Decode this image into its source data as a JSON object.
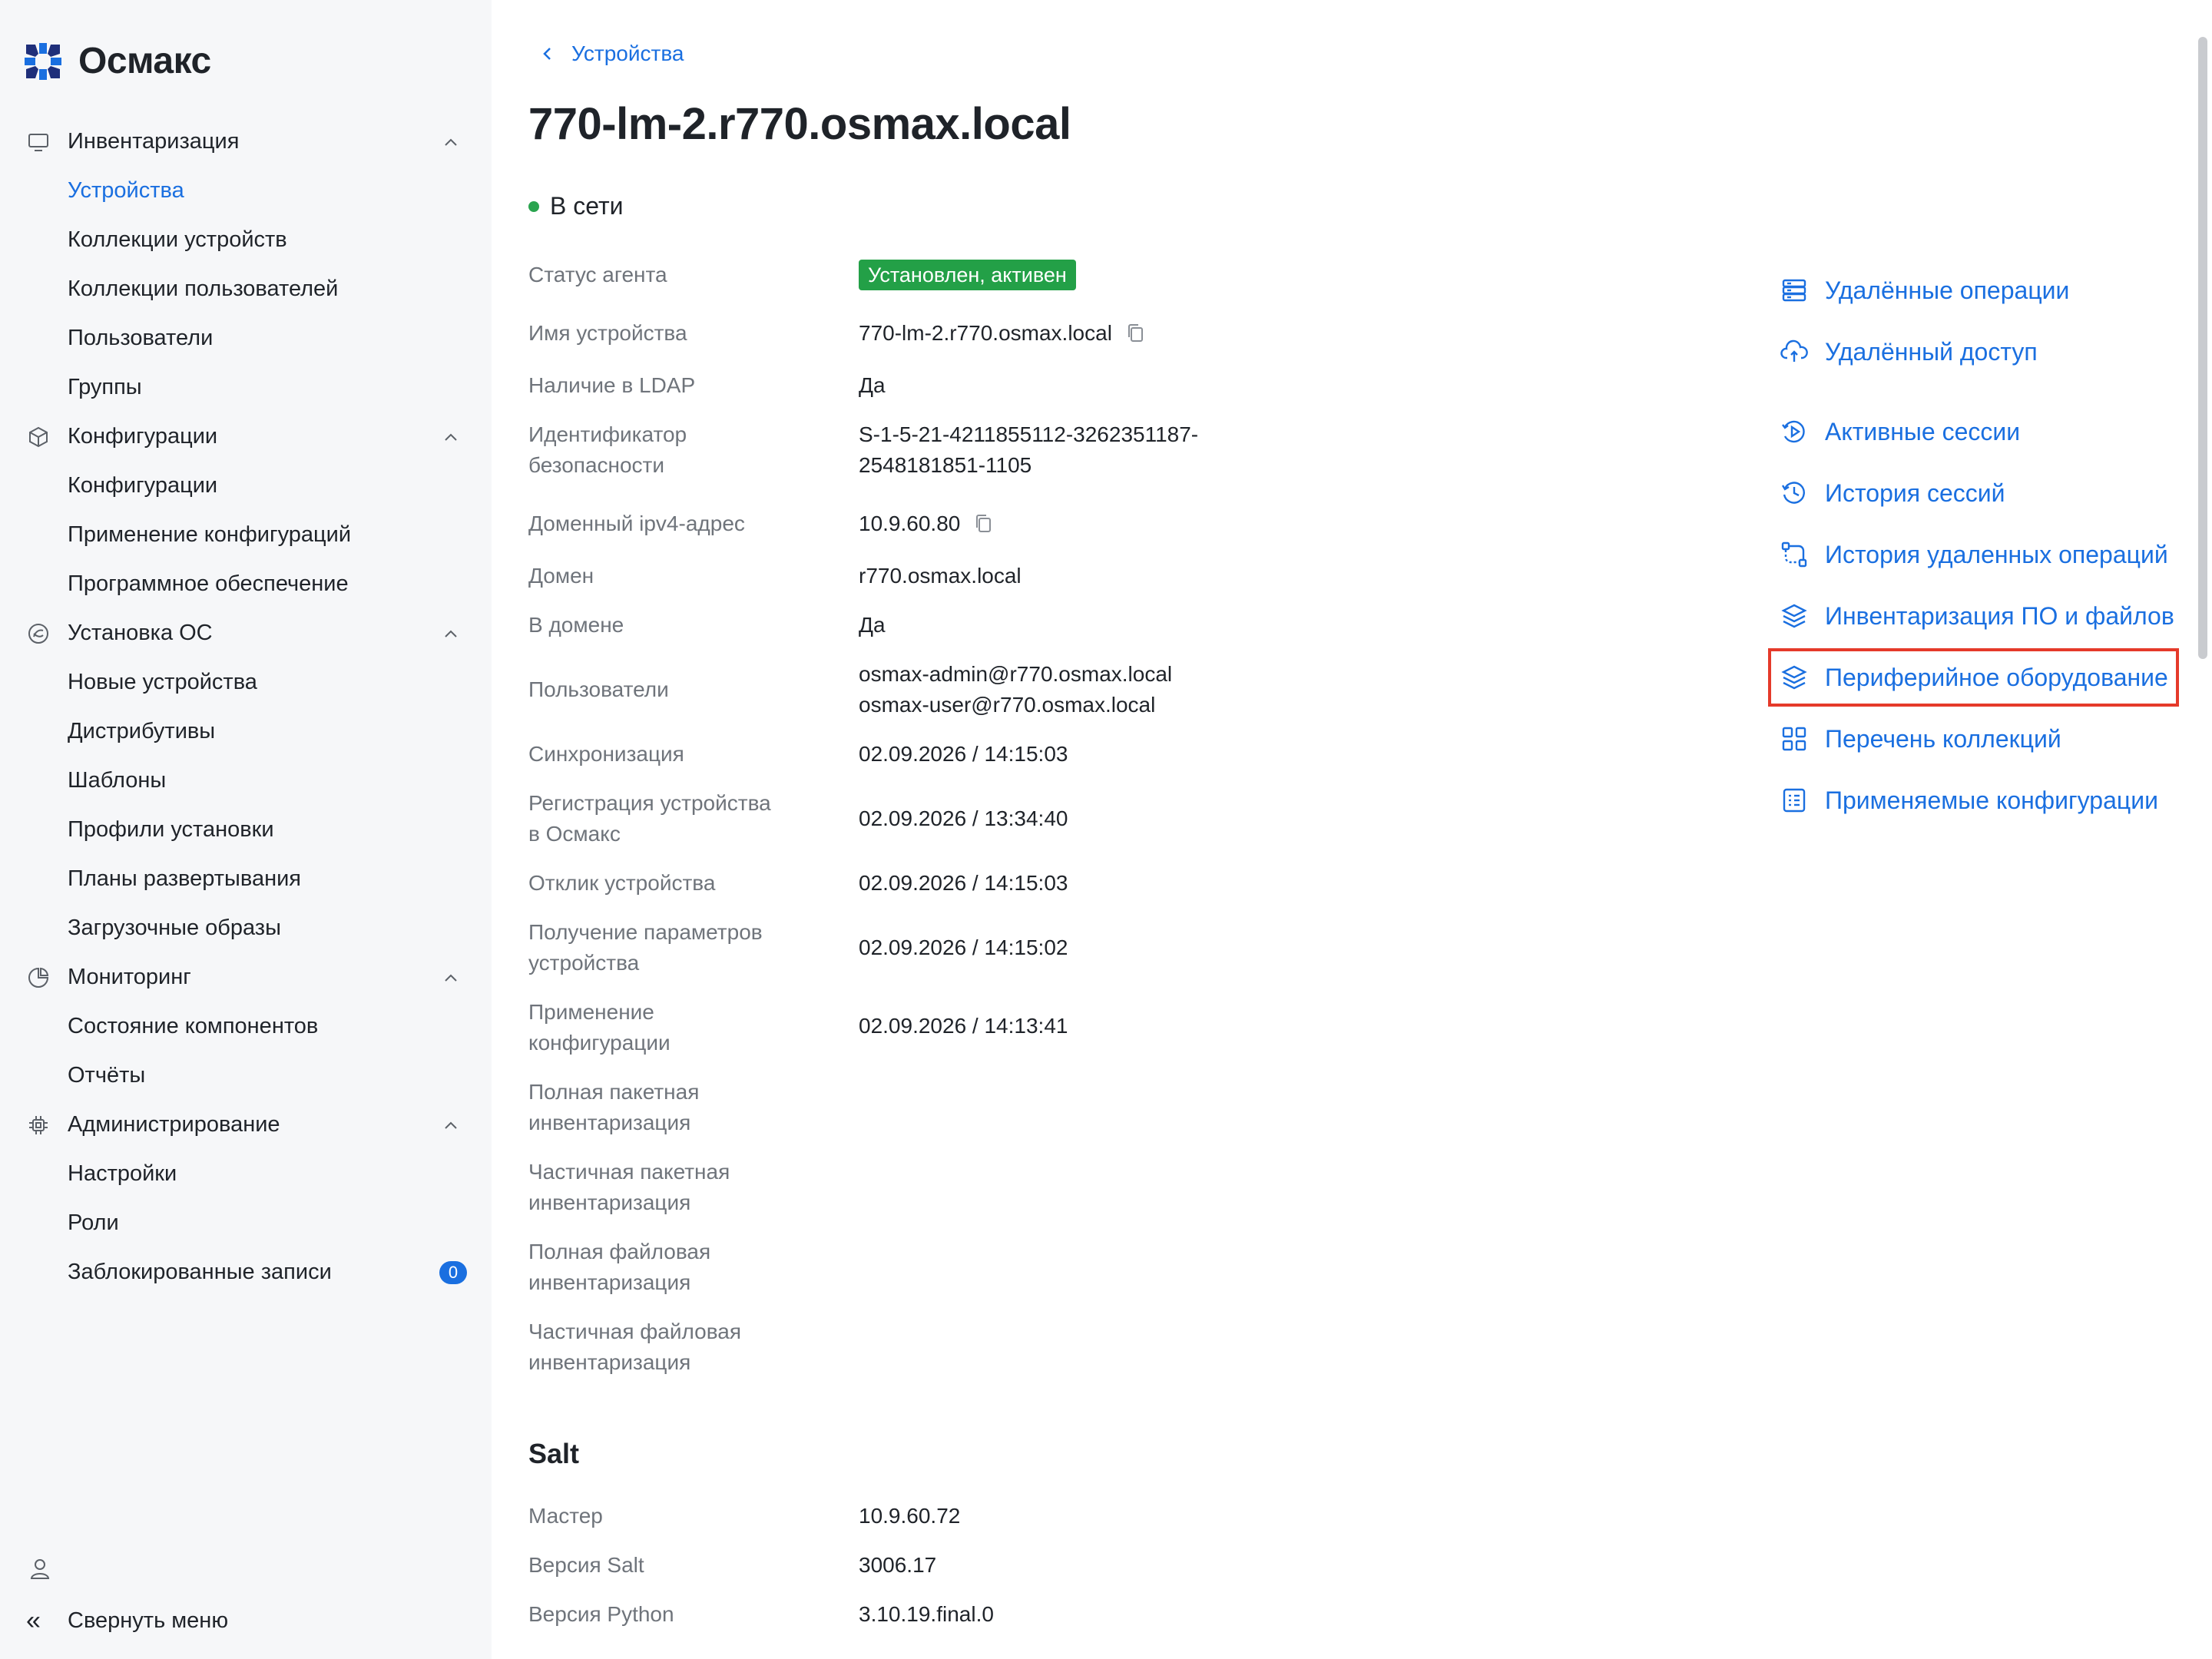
{
  "app": {
    "name": "Осмакс"
  },
  "sidebar": {
    "groups": [
      {
        "label": "Инвентаризация",
        "icon": "monitor-icon",
        "items": [
          "Устройства",
          "Коллекции устройств",
          "Коллекции пользователей",
          "Пользователи",
          "Группы"
        ]
      },
      {
        "label": "Конфигурации",
        "icon": "box-icon",
        "items": [
          "Конфигурации",
          "Применение конфигураций",
          "Программное обеспечение"
        ]
      },
      {
        "label": "Установка ОС",
        "icon": "os-install-icon",
        "items": [
          "Новые устройства",
          "Дистрибутивы",
          "Шаблоны",
          "Профили установки",
          "Планы развертывания",
          "Загрузочные образы"
        ]
      },
      {
        "label": "Мониторинг",
        "icon": "pie-chart-icon",
        "items": [
          "Состояние компонентов",
          "Отчёты"
        ]
      },
      {
        "label": "Администрирование",
        "icon": "cpu-icon",
        "items": [
          "Настройки",
          "Роли",
          "Заблокированные записи"
        ]
      }
    ],
    "active_item": "Устройства",
    "blocked_badge": "0",
    "collapse_label": "Свернуть меню"
  },
  "breadcrumb": {
    "back_label": "Устройства"
  },
  "device": {
    "title": "770-lm-2.r770.osmax.local",
    "network_status": "В сети",
    "fields": {
      "agent_status": {
        "label": "Статус агента",
        "value": "Установлен, активен"
      },
      "device_name": {
        "label": "Имя устройства",
        "value": "770-lm-2.r770.osmax.local"
      },
      "ldap": {
        "label": "Наличие в LDAP",
        "value": "Да"
      },
      "sid": {
        "label_1": "Идентификатор",
        "label_2": "безопасности",
        "value_1": "S-1-5-21-4211855112-3262351187-",
        "value_2": "2548181851-1105"
      },
      "ipv4": {
        "label": "Доменный ipv4-адрес",
        "value": "10.9.60.80"
      },
      "domain": {
        "label": "Домен",
        "value": "r770.osmax.local"
      },
      "in_domain": {
        "label": "В домене",
        "value": "Да"
      },
      "users": {
        "label": "Пользователи",
        "value_1": "osmax-admin@r770.osmax.local",
        "value_2": "osmax-user@r770.osmax.local"
      },
      "sync": {
        "label": "Синхронизация",
        "value": "02.09.2026 / 14:15:03"
      },
      "registration": {
        "label_1": "Регистрация устройства",
        "label_2": "в Осмакс",
        "value": "02.09.2026 / 13:34:40"
      },
      "response": {
        "label": "Отклик устройства",
        "value": "02.09.2026 / 14:15:03"
      },
      "params": {
        "label_1": "Получение параметров",
        "label_2": "устройства",
        "value": "02.09.2026 / 14:15:02"
      },
      "apply_config": {
        "label_1": "Применение",
        "label_2": "конфигурации",
        "value": "02.09.2026 / 14:13:41"
      },
      "full_pkg_inv": {
        "label_1": "Полная пакетная",
        "label_2": "инвентаризация"
      },
      "partial_pkg_inv": {
        "label_1": "Частичная пакетная",
        "label_2": "инвентаризация"
      },
      "full_file_inv": {
        "label_1": "Полная файловая",
        "label_2": "инвентаризация"
      },
      "partial_file_inv": {
        "label_1": "Частичная файловая",
        "label_2": "инвентаризация"
      }
    }
  },
  "salt": {
    "title": "Salt",
    "master": {
      "label": "Мастер",
      "value": "10.9.60.72"
    },
    "version": {
      "label": "Версия Salt",
      "value": "3006.17"
    },
    "python": {
      "label": "Версия Python",
      "value": "3.10.19.final.0"
    }
  },
  "actions": [
    {
      "label": "Удалённые операции",
      "icon": "server-stack-icon"
    },
    {
      "label": "Удалённый доступ",
      "icon": "cloud-access-icon"
    },
    {
      "label": "Активные сессии",
      "icon": "play-circle-icon"
    },
    {
      "label": "История сессий",
      "icon": "history-icon"
    },
    {
      "label": "История удаленных операций",
      "icon": "flow-icon"
    },
    {
      "label": "Инвентаризация ПО и файлов",
      "icon": "layers-icon"
    },
    {
      "label": "Периферийное оборудование",
      "icon": "layers-icon",
      "highlighted": true
    },
    {
      "label": "Перечень коллекций",
      "icon": "grid-icon"
    },
    {
      "label": "Применяемые конфигурации",
      "icon": "config-list-icon"
    }
  ],
  "colors": {
    "accent": "#1a6fe0",
    "success": "#23a047",
    "highlight": "#e53a2a"
  }
}
